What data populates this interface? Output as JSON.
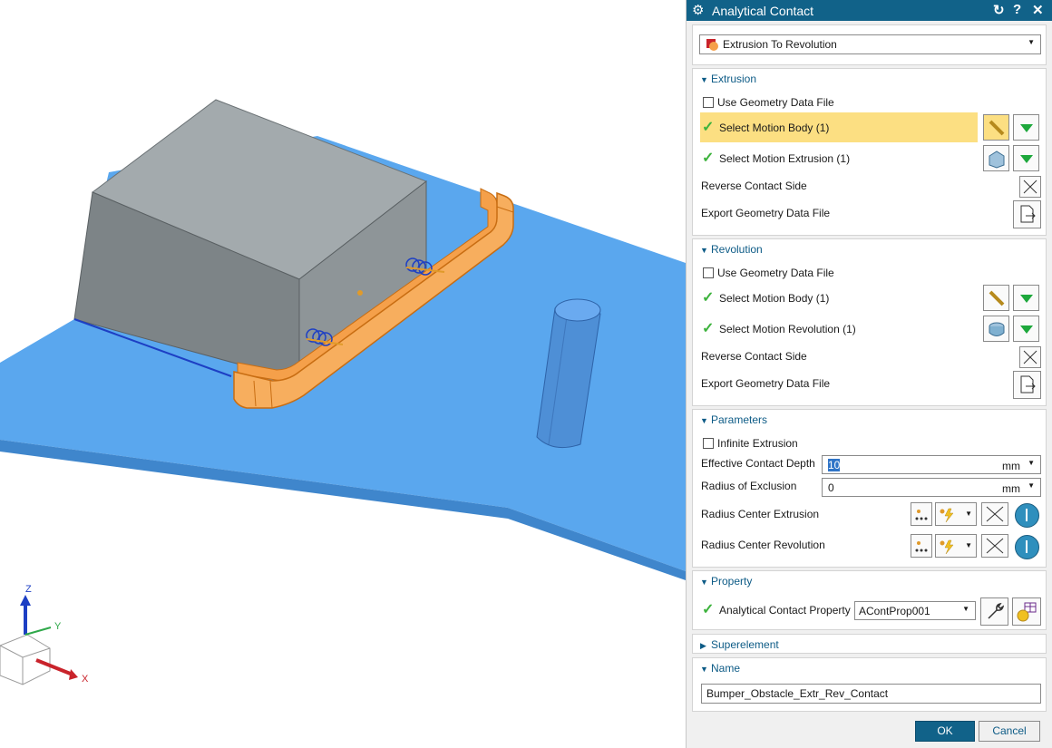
{
  "dialog": {
    "title": "Analytical Contact",
    "type_selector": "Extrusion To Revolution",
    "reset_icon": "reset-icon",
    "help_icon": "help-icon",
    "close_icon": "close-icon"
  },
  "extrusion": {
    "header": "Extrusion",
    "use_geometry": "Use Geometry Data File",
    "select_body": "Select Motion Body (1)",
    "select_extrusion": "Select Motion Extrusion (1)",
    "reverse_contact": "Reverse Contact Side",
    "export_geometry": "Export Geometry Data File"
  },
  "revolution": {
    "header": "Revolution",
    "use_geometry": "Use Geometry Data File",
    "select_body": "Select Motion Body (1)",
    "select_revolution": "Select Motion Revolution (1)",
    "reverse_contact": "Reverse Contact Side",
    "export_geometry": "Export Geometry Data File"
  },
  "parameters": {
    "header": "Parameters",
    "infinite_extrusion": "Infinite Extrusion",
    "depth_label": "Effective Contact Depth",
    "depth_value": "10",
    "depth_unit": "mm",
    "radius_label": "Radius of Exclusion",
    "radius_value": "0",
    "radius_unit": "mm",
    "center_extrusion": "Radius Center Extrusion",
    "center_revolution": "Radius Center Revolution"
  },
  "property": {
    "header": "Property",
    "label": "Analytical Contact Property",
    "value": "AContProp001"
  },
  "superelement": {
    "header": "Superelement"
  },
  "name": {
    "header": "Name",
    "value": "Bumper_Obstacle_Extr_Rev_Contact"
  },
  "buttons": {
    "ok": "OK",
    "cancel": "Cancel"
  },
  "triad": {
    "z": "Z",
    "y": "Y",
    "x": "X"
  },
  "colors": {
    "accent": "#116289",
    "selection": "#fcdf82",
    "plate": "#5aa7ee",
    "bumper": "#f5a04a",
    "check": "#3db33d"
  }
}
